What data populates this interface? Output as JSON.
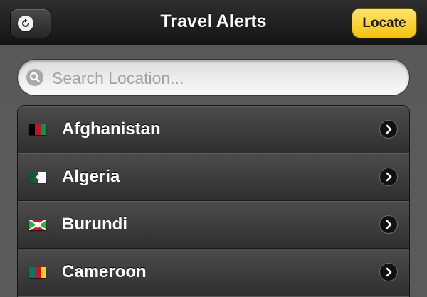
{
  "navbar": {
    "title": "Travel Alerts",
    "refresh_icon": "refresh-icon",
    "locate_label": "Locate"
  },
  "search": {
    "placeholder": "Search Location...",
    "value": "",
    "icon": "search-icon"
  },
  "countries": [
    {
      "name": "Afghanistan",
      "flag_colors": [
        "#000000",
        "#c8102e",
        "#009a3d"
      ]
    },
    {
      "name": "Algeria",
      "flag_colors": [
        "#006233",
        "#ffffff"
      ]
    },
    {
      "name": "Burundi",
      "flag_colors": [
        "#ce1126",
        "#ffffff",
        "#1eb53a"
      ]
    },
    {
      "name": "Cameroon",
      "flag_colors": [
        "#007a5e",
        "#ce1126",
        "#fcd116"
      ]
    }
  ],
  "colors": {
    "accent_locate": "#f4c20a",
    "row_text": "#ffffff"
  }
}
